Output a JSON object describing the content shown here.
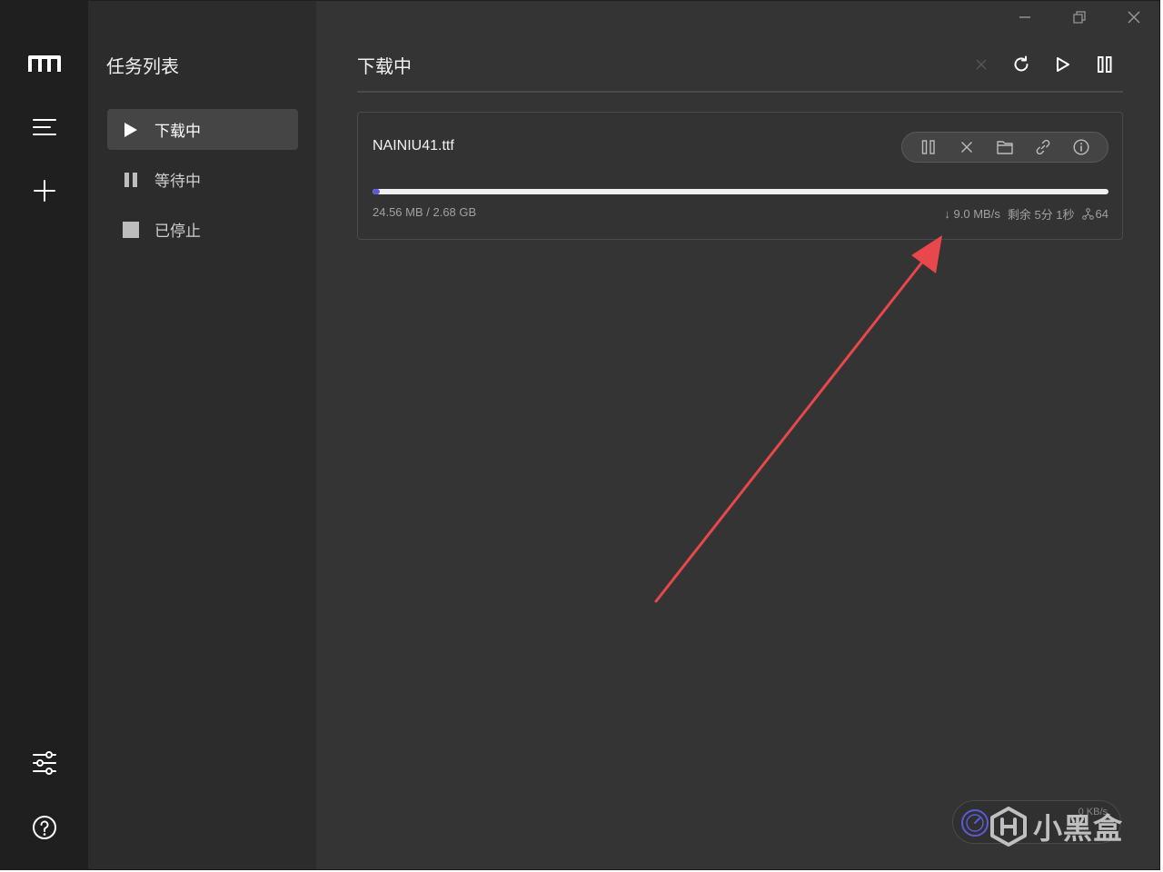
{
  "sidebar": {
    "title": "任务列表",
    "items": [
      {
        "label": "下载中",
        "icon": "play-icon",
        "active": true
      },
      {
        "label": "等待中",
        "icon": "pause-icon",
        "active": false
      },
      {
        "label": "已停止",
        "icon": "stop-icon",
        "active": false
      }
    ]
  },
  "rail": {
    "icons": [
      "app-logo-icon",
      "menu-icon",
      "add-icon",
      "settings-sliders-icon",
      "help-icon"
    ]
  },
  "main": {
    "title": "下载中",
    "toolbar": [
      "close-icon",
      "refresh-icon",
      "play-icon",
      "pause-icon"
    ]
  },
  "task": {
    "name": "NAINIU41.ttf",
    "size": "24.56 MB / 2.68 GB",
    "progress": 0.009,
    "speed": "↓ 9.0 MB/s",
    "remaining": "剩余 5分 1秒",
    "connections": "64",
    "actions": [
      "pause-icon",
      "close-icon",
      "folder-icon",
      "link-icon",
      "info-icon"
    ]
  },
  "speed_widget": {
    "value": "0 KB/s"
  },
  "watermark": {
    "text": "小黑盒"
  },
  "colors": {
    "rail_bg": "#1f1f1f",
    "sidebar_bg": "#2c2c2c",
    "main_bg": "#343434",
    "accent": "#5b5bd6",
    "annotation_arrow": "#e8474c"
  }
}
